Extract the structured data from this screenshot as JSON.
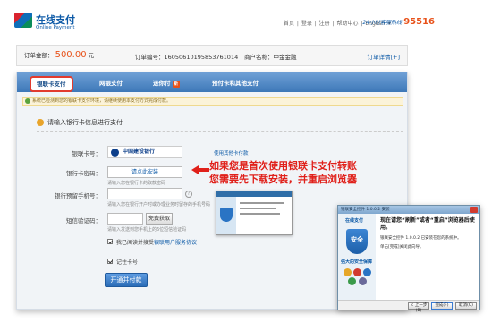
{
  "header": {
    "logo_text": "在线支付",
    "logo_sub": "Online Payment",
    "nav": [
      "首页",
      "登录",
      "注册",
      "帮助中心",
      "English"
    ],
    "hotline_label": "24小时客服热线",
    "hotline_number": "95516"
  },
  "order": {
    "amount_label": "订单金额：",
    "amount_value": "500.00",
    "amount_unit": "元",
    "number_label": "订单编号：",
    "number_value": "16050610195853761014",
    "merchant_label": "商户名称：",
    "merchant_value": "中金金融",
    "detail_link": "订单详情[+]"
  },
  "tabs": [
    {
      "label": "银联卡支付",
      "active": true
    },
    {
      "label": "网银支付",
      "active": false
    },
    {
      "label": "迷你付",
      "active": false,
      "badge": "新"
    },
    {
      "label": "预付卡和其他支付",
      "active": false
    }
  ],
  "notice_text": "系统已检测到您的银联卡支付环境，请继续使用本支付方式完成付款。",
  "section_title": "请输入银行卡信息进行支付",
  "form": {
    "card_label": "银联卡号：",
    "bank_name": "中国建设银行",
    "change_card_link": "使用其他卡付款",
    "password_label": "银行卡密码：",
    "install_text": "请点此安装",
    "password_hint": "请输入您在银行卡的取款密码",
    "phone_label": "银行预留手机号：",
    "phone_hint": "请输入您在银行开户时或办理业务时留存的手机号码",
    "sms_label": "短信验证码：",
    "sms_button": "免费获取",
    "sms_hint": "请输入发送到您手机上的6位短信验证码",
    "agree_text": "我已阅读并接受",
    "agree_link": "银联用户服务协议",
    "remember_text": "记住卡号",
    "submit_label": "开通并付款"
  },
  "annotation": {
    "line1": "如果您是首次使用银联卡支付转账",
    "line2": "您需要先下载安装，并重启浏览器"
  },
  "dialog": {
    "title": "银联安全控件 1.0.0.2 安装",
    "brand": "在线支付",
    "shield_text": "安全",
    "slogan": "强大的安全保障",
    "heading": "现在请您“刷新”或者“重启”浏览器后使用。",
    "text1": "银联安全控件 1.0.0.2 已安装在您的系统中。",
    "text2": "单击[完成]关闭此向导。",
    "back_button": "< 上一步(B)",
    "finish_button": "完成(F)",
    "cancel_button": "取消(C)"
  },
  "colors": {
    "brand_blue": "#0d5aa7",
    "accent_orange": "#e8521a",
    "annotation_red": "#e0201a"
  }
}
